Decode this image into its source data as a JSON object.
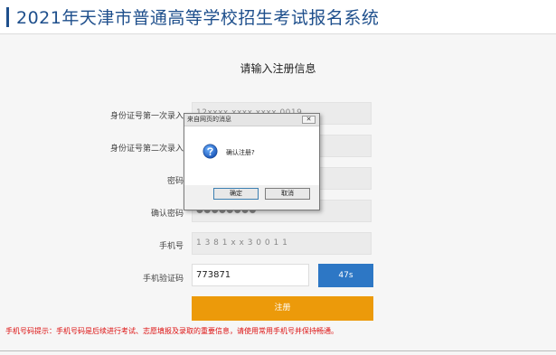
{
  "header": {
    "title": "2021年天津市普通高等学校招生考试报名系统"
  },
  "form": {
    "title": "请输入注册信息",
    "fields": [
      {
        "label": "身份证号第一次录入",
        "value": "12xxxx xxxx xxxx 0019"
      },
      {
        "label": "身份证号第二次录入",
        "value": ""
      },
      {
        "label": "密码",
        "value": ""
      },
      {
        "label": "确认密码",
        "value": "●●●●●●●●"
      },
      {
        "label": "手机号",
        "value": "1 3 8 1 x x 3 0 0 1 1"
      },
      {
        "label": "手机验证码",
        "value": "773871"
      }
    ],
    "countdown_button": "47s",
    "submit_button": "注册"
  },
  "notice": "手机号码提示：手机号码是后续进行考试、志愿填报及录取的重要信息，请使用常用手机号并保持畅通。",
  "dialog": {
    "title": "来自网页的消息",
    "close_label": "✕",
    "message": "确认注册?",
    "ok_label": "确定",
    "cancel_label": "取消",
    "icon": "question-icon"
  },
  "colors": {
    "title_blue": "#1e4f8c",
    "send_button": "#2d77c5",
    "submit_button": "#ec9a0a",
    "notice_red": "#dd1111"
  }
}
